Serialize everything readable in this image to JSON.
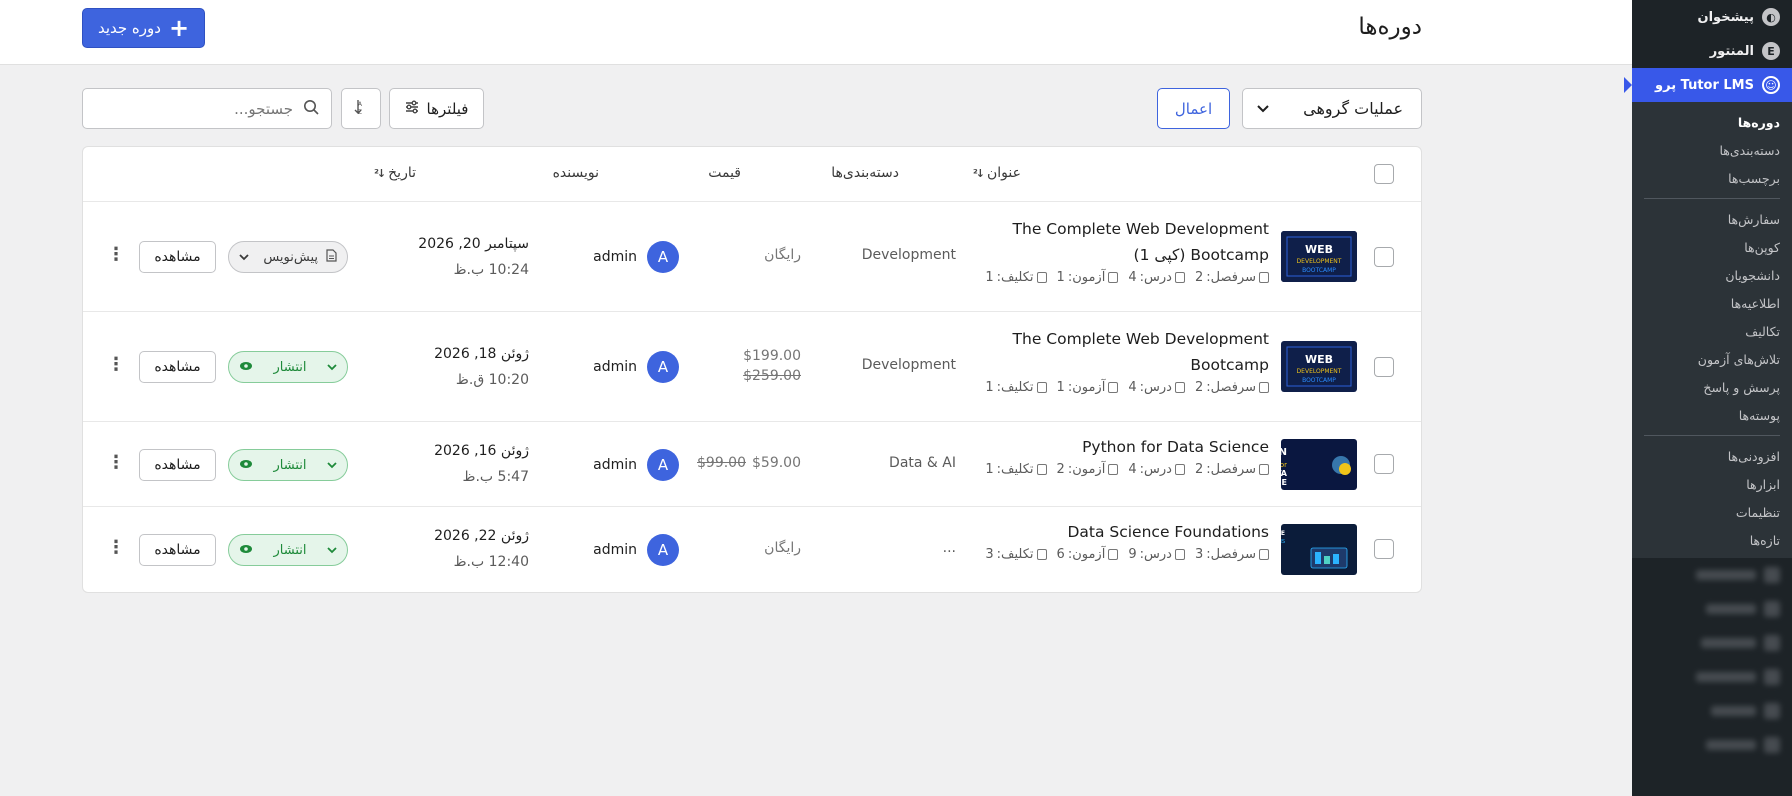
{
  "header": {
    "page_title": "دوره‌ها",
    "new_course_label": "دوره جدید"
  },
  "toolbar": {
    "bulk_actions": "عملیات گروهی",
    "apply": "اعمال",
    "filters": "فیلترها",
    "search_placeholder": "جستجو..."
  },
  "table": {
    "columns": {
      "title": "عنوان",
      "categories": "دسته‌بندی‌ها",
      "price": "قیمت",
      "author": "نویسنده",
      "date": "تاریخ"
    },
    "meta_labels": {
      "topic": "سرفصل:",
      "lesson": "درس:",
      "quiz": "آزمون:",
      "assignment": "تکلیف:"
    },
    "view_label": "مشاهده",
    "rows": [
      {
        "title": "The Complete Web Development Bootcamp (کپی 1)",
        "topics": "2",
        "lessons": "4",
        "quizzes": "1",
        "assignments": "1",
        "category": "Development",
        "price": "رایگان",
        "price_old": "",
        "author": "admin",
        "avatar": "A",
        "date": "سپتامبر 20, 2026",
        "time": "10:24 ب.ظ",
        "status": "پیش‌نویس",
        "thumb": "WEB DEVELOPMENT BOOTCAMP"
      },
      {
        "title": "The Complete Web Development Bootcamp",
        "topics": "2",
        "lessons": "4",
        "quizzes": "1",
        "assignments": "1",
        "category": "Development",
        "price": "$199.00",
        "price_old": "$259.00",
        "author": "admin",
        "avatar": "A",
        "date": "ژوئن 18, 2026",
        "time": "10:20 ق.ظ",
        "status": "انتشار",
        "thumb": "WEB DEVELOPMENT BOOTCAMP"
      },
      {
        "title": "Python for Data Science",
        "topics": "2",
        "lessons": "4",
        "quizzes": "2",
        "assignments": "1",
        "category": "Data & AI",
        "price": "$59.00",
        "price_old": "$99.00",
        "author": "admin",
        "avatar": "A",
        "date": "ژوئن 16, 2026",
        "time": "5:47 ب.ظ",
        "status": "انتشار",
        "thumb": "PYTHON DATA SCIENCE"
      },
      {
        "title": "Data Science Foundations",
        "topics": "3",
        "lessons": "9",
        "quizzes": "6",
        "assignments": "3",
        "category": "...",
        "price": "رایگان",
        "price_old": "",
        "author": "admin",
        "avatar": "A",
        "date": "ژوئن 22, 2026",
        "time": "12:40 ب.ظ",
        "status": "انتشار",
        "thumb": "DATA SCIENCE FOUNDATIONS"
      }
    ]
  },
  "sidebar": {
    "top": [
      {
        "label": "پیشخوان",
        "icon": "dashboard-icon"
      },
      {
        "label": "المنتور",
        "icon": "elementor-icon"
      },
      {
        "label": "Tutor LMS پرو",
        "icon": "tutor-icon"
      }
    ],
    "submenu": [
      "دوره‌ها",
      "دسته‌بندی‌ها",
      "برچسب‌ها",
      "سفارش‌ها",
      "کوپن‌ها",
      "دانشجویان",
      "اطلاعیه‌ها",
      "تکالیف",
      "تلاش‌های آزمون",
      "پرسش و پاسخ",
      "پوسته‌ها",
      "افزودنی‌ها",
      "ابزارها",
      "تنظیمات",
      "تازه‌ها"
    ]
  },
  "colors": {
    "primary": "#3e64de",
    "admin_bg": "#1d2327",
    "admin_active": "#3858e9",
    "published_bg": "#e5f5ea",
    "published_text": "#1e8a3a"
  }
}
